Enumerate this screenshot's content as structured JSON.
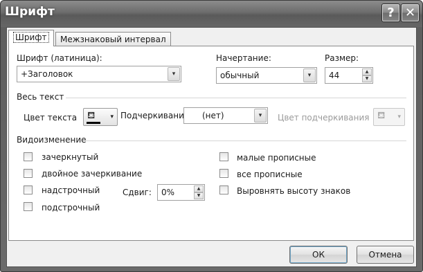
{
  "window": {
    "title": "Шрифт",
    "help_glyph": "?",
    "close_glyph": "✕"
  },
  "tabs": [
    {
      "label": "Шрифт",
      "active": true
    },
    {
      "label": "Межзнаковый интервал",
      "active": false
    }
  ],
  "font": {
    "latin_label": "Шрифт (латиница):",
    "latin_value": "+Заголовок",
    "style_label": "Начертание:",
    "style_value": "обычный",
    "size_label": "Размер:",
    "size_value": "44"
  },
  "all_text": {
    "section_label": "Весь текст",
    "font_color_label": "Цвет текста",
    "underline_label": "Подчеркивание",
    "underline_value": "(нет)",
    "underline_color_label": "Цвет подчеркивания"
  },
  "effects": {
    "section_label": "Видоизменение",
    "left": [
      {
        "label": "зачеркнутый",
        "checked": false
      },
      {
        "label": "двойное зачеркивание",
        "checked": false
      },
      {
        "label": "надстрочный",
        "checked": false
      },
      {
        "label": "подстрочный",
        "checked": false
      }
    ],
    "right": [
      {
        "label": "малые прописные",
        "checked": false
      },
      {
        "label": "все прописные",
        "checked": false
      },
      {
        "label": "Выровнять высоту знаков",
        "checked": false
      }
    ],
    "offset_label": "Сдвиг:",
    "offset_value": "0%"
  },
  "buttons": {
    "ok": "ОК",
    "cancel": "Отмена"
  },
  "icons": {
    "dropdown": "▾",
    "spin_up": "▲",
    "spin_down": "▼",
    "bucket": "fill-bucket-icon"
  }
}
